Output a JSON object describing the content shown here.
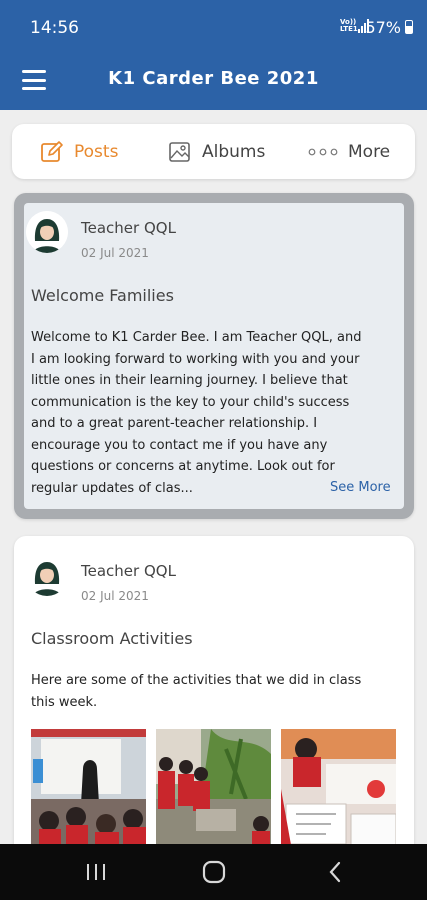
{
  "status": {
    "time": "14:56",
    "network": "Vo)) LTE1",
    "battery": "57%"
  },
  "header": {
    "title": "K1 Carder Bee 2021"
  },
  "tabs": [
    {
      "label": "Posts",
      "icon": "edit-icon",
      "active": true
    },
    {
      "label": "Albums",
      "icon": "photo-album-icon",
      "active": false
    },
    {
      "label": "More",
      "icon": "more-dots-icon",
      "active": false
    }
  ],
  "posts": [
    {
      "author": "Teacher QQL",
      "date": "02 Jul 2021",
      "title": "Welcome Families",
      "lines": [
        "Welcome to K1 Carder Bee. I am Teacher QQL, and",
        "I am looking forward to working with you and your",
        "little ones in their learning journey. I believe that",
        "communication is the key to your child's success",
        "and to a great parent-teacher relationship. I",
        "encourage you to contact me if you have any",
        "questions or concerns at anytime. Look out for",
        "regular updates of clas..."
      ],
      "see_more": "See More"
    },
    {
      "author": "Teacher QQL",
      "date": "02 Jul 2021",
      "title": "Classroom Activities",
      "lines": [
        "Here are some of the activities that we did in class",
        "this week."
      ],
      "photos": [
        "classroom-group-photo",
        "outdoor-garden-photo",
        "table-writing-photo"
      ]
    }
  ],
  "colors": {
    "brand": "#2c62a7",
    "accent": "#e8892e",
    "link": "#2c62a7"
  },
  "navbar": {
    "icons": [
      "recent-apps-icon",
      "home-icon",
      "back-icon"
    ]
  }
}
